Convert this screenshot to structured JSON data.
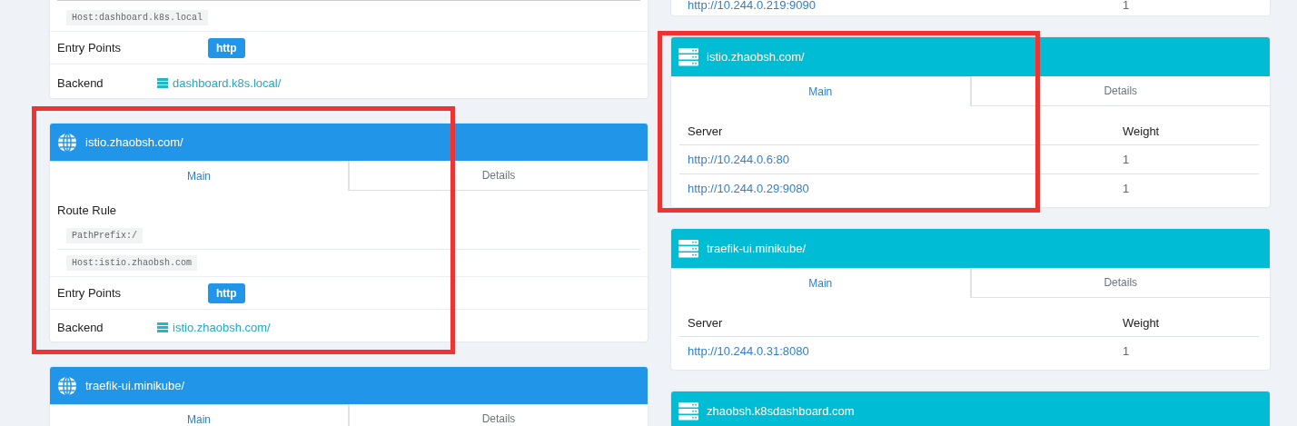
{
  "columns": [
    {
      "cards": [
        {
          "kind": "frontend",
          "highlighted": false,
          "route_rules": [
            "Host:dashboard.k8s.local"
          ],
          "entry_points_label": "Entry Points",
          "entry_points": [
            "http"
          ],
          "backend_label": "Backend",
          "backend": "dashboard.k8s.local/"
        },
        {
          "kind": "frontend",
          "title": "istio.zhaobsh.com/",
          "highlighted": true,
          "tabs": [
            {
              "label": "Main",
              "selected": true
            },
            {
              "label": "Details",
              "selected": false
            }
          ],
          "route_rule_label": "Route Rule",
          "route_rules": [
            "PathPrefix:/",
            "Host:istio.zhaobsh.com"
          ],
          "entry_points_label": "Entry Points",
          "entry_points": [
            "http"
          ],
          "backend_label": "Backend",
          "backend": "istio.zhaobsh.com/"
        },
        {
          "kind": "frontend",
          "title": "traefik-ui.minikube/",
          "highlighted": false,
          "tabs": [
            {
              "label": "Main",
              "selected": true
            },
            {
              "label": "Details",
              "selected": false
            }
          ]
        }
      ]
    },
    {
      "cards": [
        {
          "kind": "backend",
          "highlighted": false,
          "servers": [
            {
              "url": "http://10.244.0.219:9090",
              "weight": "1"
            }
          ]
        },
        {
          "kind": "backend",
          "title": "istio.zhaobsh.com/",
          "highlighted": true,
          "tabs": [
            {
              "label": "Main",
              "selected": true
            },
            {
              "label": "Details",
              "selected": false
            }
          ],
          "columns": [
            "Server",
            "Weight"
          ],
          "servers": [
            {
              "url": "http://10.244.0.6:80",
              "weight": "1"
            },
            {
              "url": "http://10.244.0.29:9080",
              "weight": "1"
            }
          ]
        },
        {
          "kind": "backend",
          "title": "traefik-ui.minikube/",
          "highlighted": false,
          "tabs": [
            {
              "label": "Main",
              "selected": true
            },
            {
              "label": "Details",
              "selected": false
            }
          ],
          "columns": [
            "Server",
            "Weight"
          ],
          "servers": [
            {
              "url": "http://10.244.0.31:8080",
              "weight": "1"
            }
          ]
        },
        {
          "kind": "backend",
          "title": "zhaobsh.k8sdashboard.com",
          "highlighted": false
        }
      ]
    }
  ]
}
